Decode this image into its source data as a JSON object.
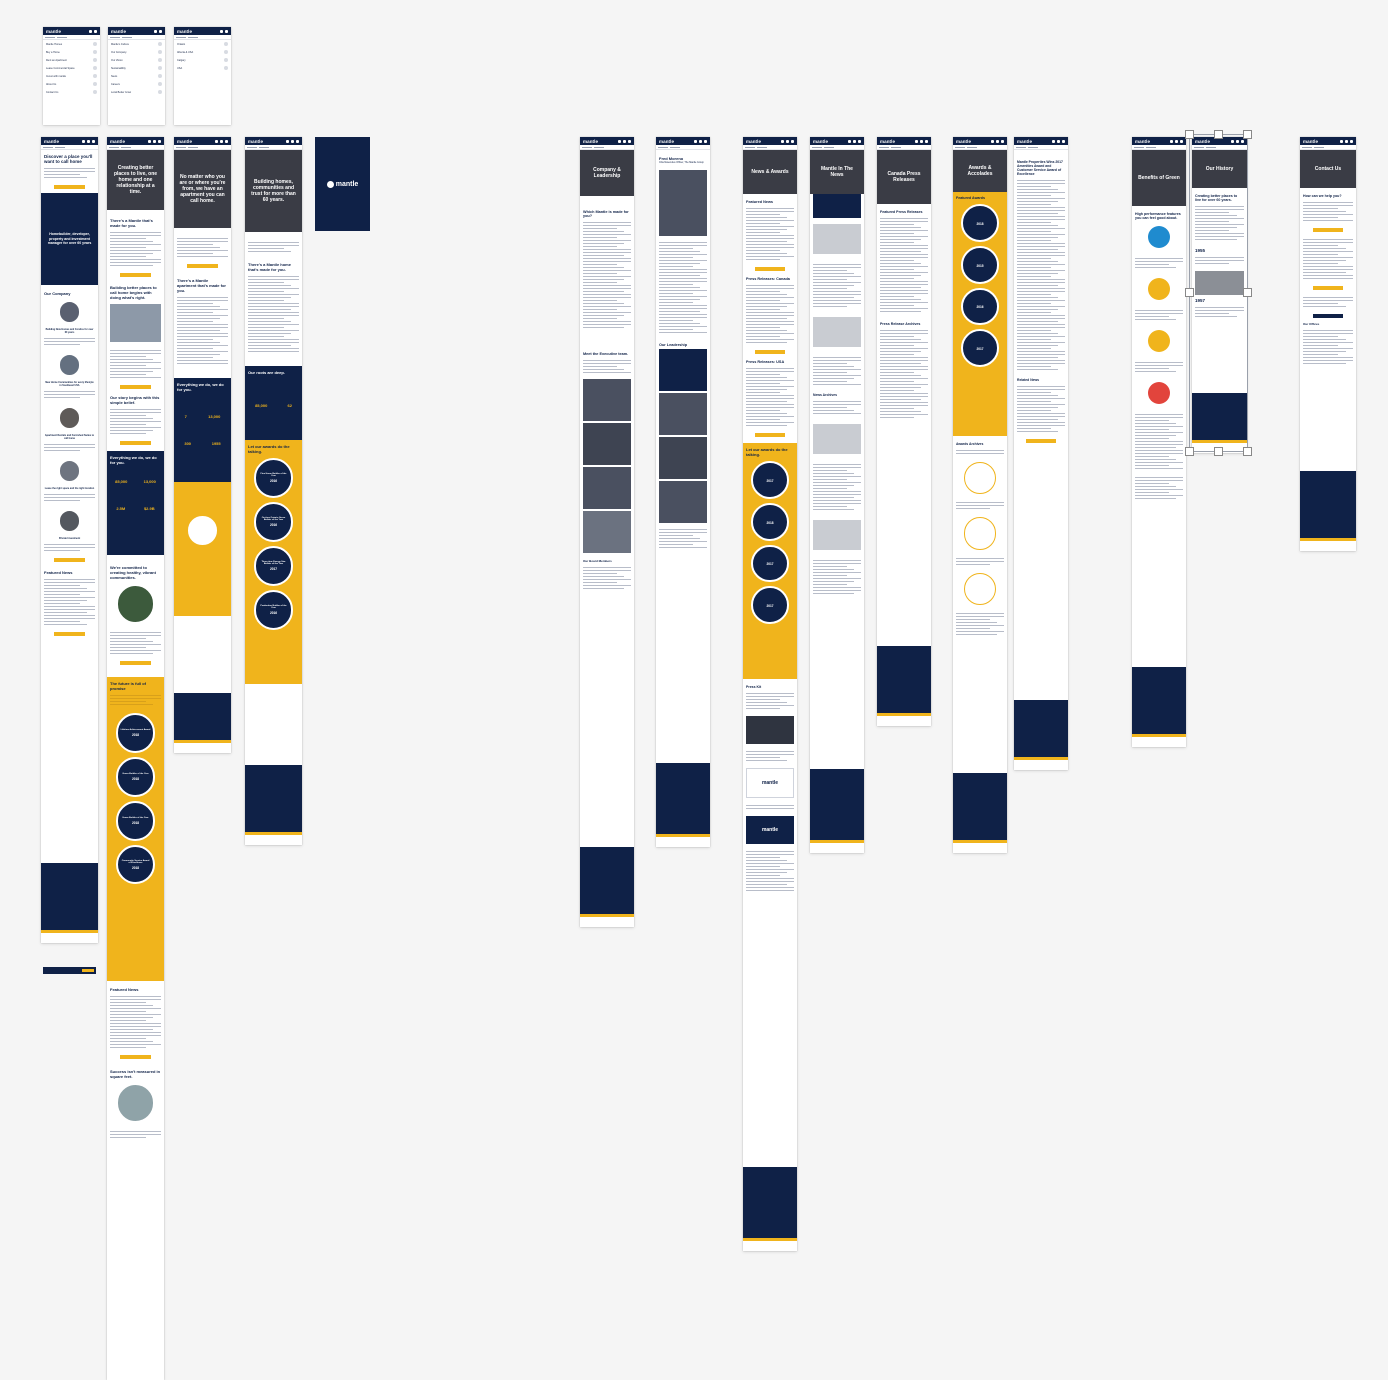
{
  "brand": {
    "name": "mantle",
    "colors": {
      "navy": "#0f2147",
      "yellow": "#f0b41c",
      "canvas": "#f5f5f5"
    }
  },
  "menus": {
    "a": {
      "items": [
        "Mantle Homes",
        "Buy a Home",
        "Rent an Apartment",
        "Lease Commercial Space",
        "Invest with mantle",
        "About Us",
        "Contact Us"
      ]
    },
    "b": {
      "items": [
        "Mantle's Culture",
        "Our Company",
        "Our Vision",
        "Sustainability",
        "News",
        "Careers",
        "Local Better Grow"
      ]
    },
    "c": {
      "items": [
        "Ontario",
        "Alberta & USA",
        "Calgary",
        "USA"
      ]
    }
  },
  "splash": {
    "logo": "mantle"
  },
  "screens": {
    "home": {
      "headline": "Discover a place you'll want to call home",
      "promo": "Homebuilder, developer, property and investment manager for over 60 years",
      "company_heading": "Our Company",
      "item1": "Building New Homes and Condos for over 60 years",
      "item2": "New Home Communities for every lifestyle in Southeast USA",
      "item3": "Apartment Rentals and Furnished Suites to call home",
      "item4": "Lease the right space and the right location",
      "item5": "Private Investment",
      "news_heading": "Featured News"
    },
    "culture": {
      "hero": "Creating better places to live, one home and one relationship at a time.",
      "section1": "There's a Mantle that's made for you.",
      "section2": "Building better places to call home begins with doing what's right.",
      "section3": "Our story begins with this simple belief.",
      "stats_heading": "Everything we do, we do for you.",
      "stat1": "85,000",
      "stat2": "13,000",
      "stat3": "2.5M",
      "stat4": "$2.9B",
      "section4": "We're committed to creating healthy, vibrant communities.",
      "future": "The future is full of promise",
      "award1": "Lifetime Achievement Award",
      "award2": "Green Builder of the Year",
      "award3": "Home Builder of the Year",
      "award4": "Community Service Award of Excellence",
      "year_2018": "2018",
      "news": "Featured News",
      "success": "Success isn't measured in square feet."
    },
    "rentals": {
      "hero": "No matter who you are or where you're from, we have an apartment you can call home.",
      "section1": "There's a Mantle apartment that's made for you.",
      "stats": "Everything we do, we do for you.",
      "n1": "7",
      "n2": "13,000",
      "n3": "300",
      "n4": "1955"
    },
    "communities": {
      "hero": "Building homes, communities and trust for more than 60 years.",
      "section1": "There's a Mantle home that's made for you.",
      "roots": "Our roots are deep.",
      "n1": "85,000",
      "n2": "62",
      "awards": "Let our awards do the talking.",
      "a1": "Fine Home Builder of the Year",
      "a2": "On-time Ontario Green Builder of the Year",
      "a3": "Three-time Energy Star Builder of the Year",
      "a4": "Production Builder of the Year",
      "y1": "2016",
      "y2": "2016",
      "y3": "2017",
      "y4": "2016"
    },
    "leadership": {
      "hero": "Company & Leadership",
      "q": "Which Mantle is made for you?",
      "meet": "Meet the Executive team.",
      "board": "Our Board Members"
    },
    "bio": {
      "name": "Fred Moreno",
      "role": "Chief Executive Officer, The Mantle Group",
      "leadership": "Our Leadership"
    },
    "news": {
      "hero": "News & Awards",
      "featured": "Featured News",
      "canada": "Press Releases: Canada",
      "usa": "Press Releases: USA",
      "awards": "Let our awards do the talking.",
      "y1": "2017",
      "y2": "2018",
      "y3": "2017",
      "y4": "2017",
      "kit": "Press Kit",
      "logo1": "mantle",
      "logo2": "mantle"
    },
    "inthenews": {
      "hero": "Mantle In The News",
      "archives": "News Archives"
    },
    "press": {
      "hero": "Canada Press Releases",
      "featured": "Featured Press Releases",
      "archives": "Press Release Archives"
    },
    "awards": {
      "hero": "Awards & Accolades",
      "featured": "Featured Awards",
      "y1": "2018",
      "y2": "2015",
      "y3": "2016",
      "y4": "2017",
      "archives": "Awards Archives"
    },
    "article": {
      "title": "Mantle Properties Wins 2017 Amenities Award and Customer Service Award of Excellence",
      "related": "Related News"
    },
    "green": {
      "hero": "Benefits of Green",
      "h": "High performance features you can feel good about."
    },
    "history": {
      "hero": "Our History",
      "h": "Creating better places to live for over 60 years.",
      "y1": "1955",
      "y2": "1957"
    },
    "contact": {
      "hero": "Contact Us",
      "h": "How can we help you?",
      "offices": "Our Offices"
    }
  }
}
